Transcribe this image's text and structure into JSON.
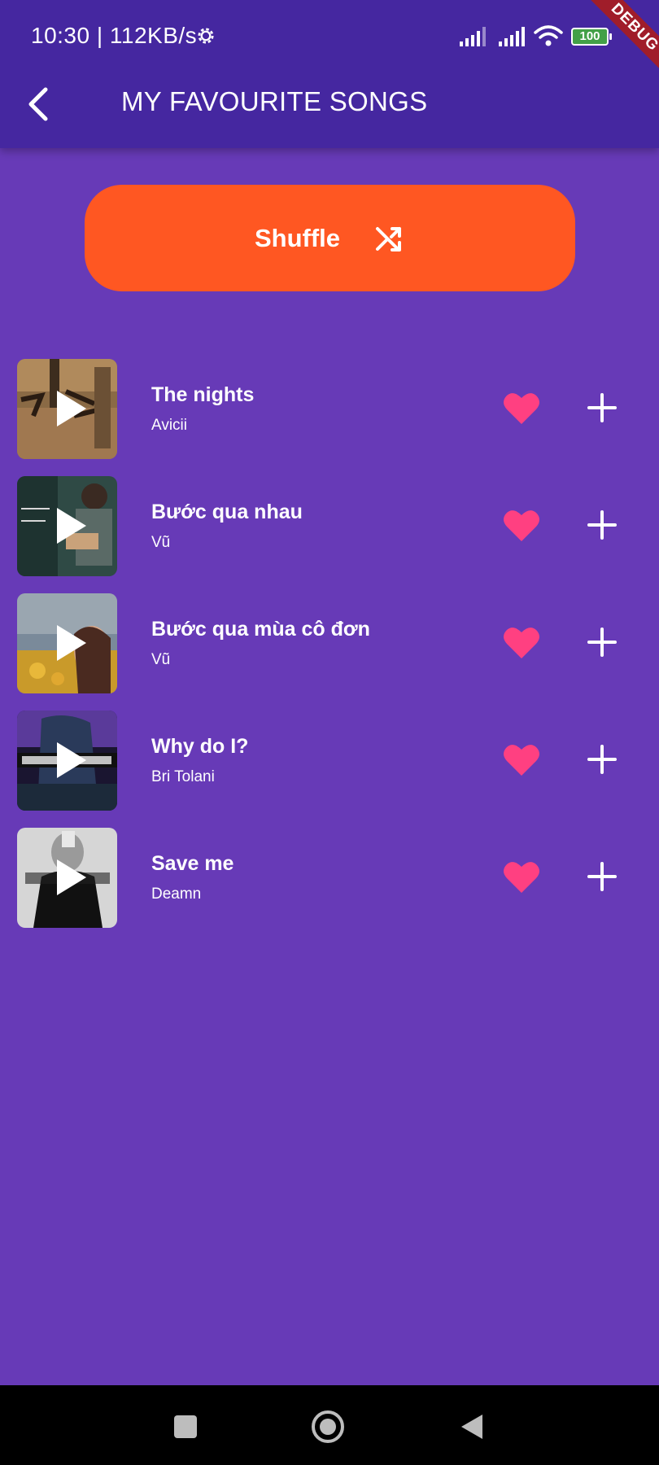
{
  "status_bar": {
    "time": "10:30 | 112KB/s",
    "battery": "100",
    "debug_label": "DEBUG",
    "icons": [
      "gear-icon",
      "signal-icon",
      "signal-icon",
      "wifi-icon",
      "battery-icon"
    ]
  },
  "header": {
    "title": "MY FAVOURITE SONGS",
    "back_icon": "chevron-left-icon"
  },
  "shuffle": {
    "label": "Shuffle",
    "icon": "shuffle-icon",
    "color": "#ff5722"
  },
  "songs": [
    {
      "title": "The nights",
      "artist": "Avicii"
    },
    {
      "title": "Bước qua nhau",
      "artist": "Vũ"
    },
    {
      "title": "Bước qua mùa cô đơn",
      "artist": "Vũ"
    },
    {
      "title": "Why do I?",
      "artist": "Bri Tolani"
    },
    {
      "title": "Save me",
      "artist": "Deamn"
    }
  ],
  "colors": {
    "background": "#673ab7",
    "app_bar": "#4527a0",
    "heart": "#ff4081",
    "accent": "#ff5722"
  },
  "nav_bar": {
    "icons": [
      "recents-icon",
      "home-icon",
      "back-triangle-icon"
    ]
  }
}
